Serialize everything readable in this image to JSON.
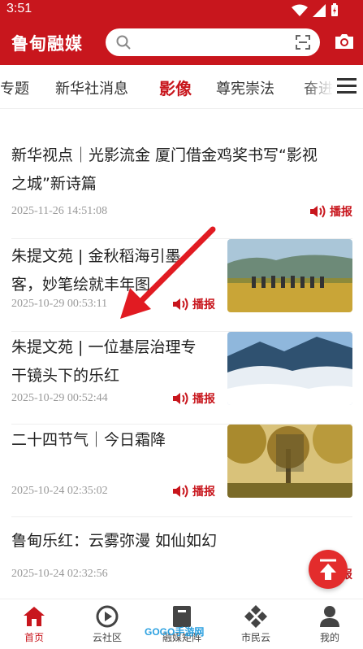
{
  "status_bar": {
    "time": "3:51"
  },
  "app": {
    "name": "鲁甸融媒"
  },
  "tabs": [
    "专题",
    "新华社消息",
    "影像",
    "尊宪崇法",
    "奋进"
  ],
  "active_tab": "影像",
  "news": [
    {
      "title_line1": "新华视点｜光影流金 厦门借金鸡奖书写“影视",
      "title_line2": "之城”新诗篇",
      "date": "2025-11-26 14:51:08",
      "play_label": "播报"
    },
    {
      "title_line1": "朱提文苑 | 金秋稻海引墨",
      "title_line2": "客，妙笔绘就丰年图",
      "date": "2025-10-29 00:53:11",
      "play_label": "播报"
    },
    {
      "title_line1": "朱提文苑 | 一位基层治理专",
      "title_line2": "干镜头下的乐红",
      "date": "2025-10-29 00:52:44",
      "play_label": "播报"
    },
    {
      "title_line1": "二十四节气｜今日霜降",
      "date": "2025-10-24 02:35:02",
      "play_label": "播报"
    },
    {
      "title_line1": "鲁甸乐红：云雾弥漫 如仙如幻",
      "date": "2025-10-24 02:32:56",
      "play_label": "播报"
    }
  ],
  "bottom_nav": [
    {
      "label": "首页"
    },
    {
      "label": "云社区"
    },
    {
      "label": "融媒矩阵"
    },
    {
      "label": "市民云"
    },
    {
      "label": "我的"
    }
  ],
  "watermark": "GOGO手游网",
  "colors": {
    "brand": "#c8161d",
    "accent": "#e32c2c"
  }
}
